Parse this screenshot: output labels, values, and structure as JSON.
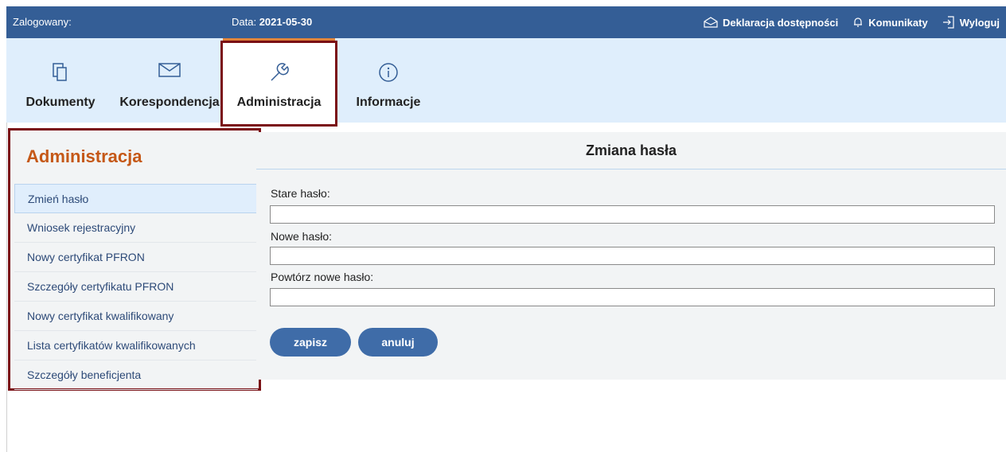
{
  "topbar": {
    "login_label": "Zalogowany:",
    "date_label": "Data:",
    "date_value": "2021-05-30",
    "accessibility": "Deklaracja dostępności",
    "messages": "Komunikaty",
    "logout": "Wyloguj"
  },
  "nav": {
    "tabs": [
      {
        "label": "Dokumenty",
        "icon": "documents-icon"
      },
      {
        "label": "Korespondencja",
        "icon": "envelope-icon"
      },
      {
        "label": "Administracja",
        "icon": "wrench-icon"
      },
      {
        "label": "Informacje",
        "icon": "info-icon"
      }
    ],
    "active": "Administracja"
  },
  "sidebar": {
    "title": "Administracja",
    "items": [
      {
        "label": "Zmień hasło"
      },
      {
        "label": "Wniosek rejestracyjny"
      },
      {
        "label": "Nowy certyfikat PFRON"
      },
      {
        "label": "Szczegóły certyfikatu PFRON"
      },
      {
        "label": "Nowy certyfikat kwalifikowany"
      },
      {
        "label": "Lista certyfikatów kwalifikowanych"
      },
      {
        "label": "Szczegóły beneficjenta"
      }
    ]
  },
  "form": {
    "title": "Zmiana hasła",
    "old_password_label": "Stare hasło:",
    "old_password_value": "",
    "new_password_label": "Nowe hasło:",
    "new_password_value": "",
    "repeat_password_label": "Powtórz nowe hasło:",
    "repeat_password_value": "",
    "save_label": "zapisz",
    "cancel_label": "anuluj"
  },
  "colors": {
    "topbar": "#345e96",
    "nav_band": "#dfeefc",
    "accent_orange": "#c55817",
    "highlight_border": "#7a1015",
    "button": "#3f6ca8"
  }
}
